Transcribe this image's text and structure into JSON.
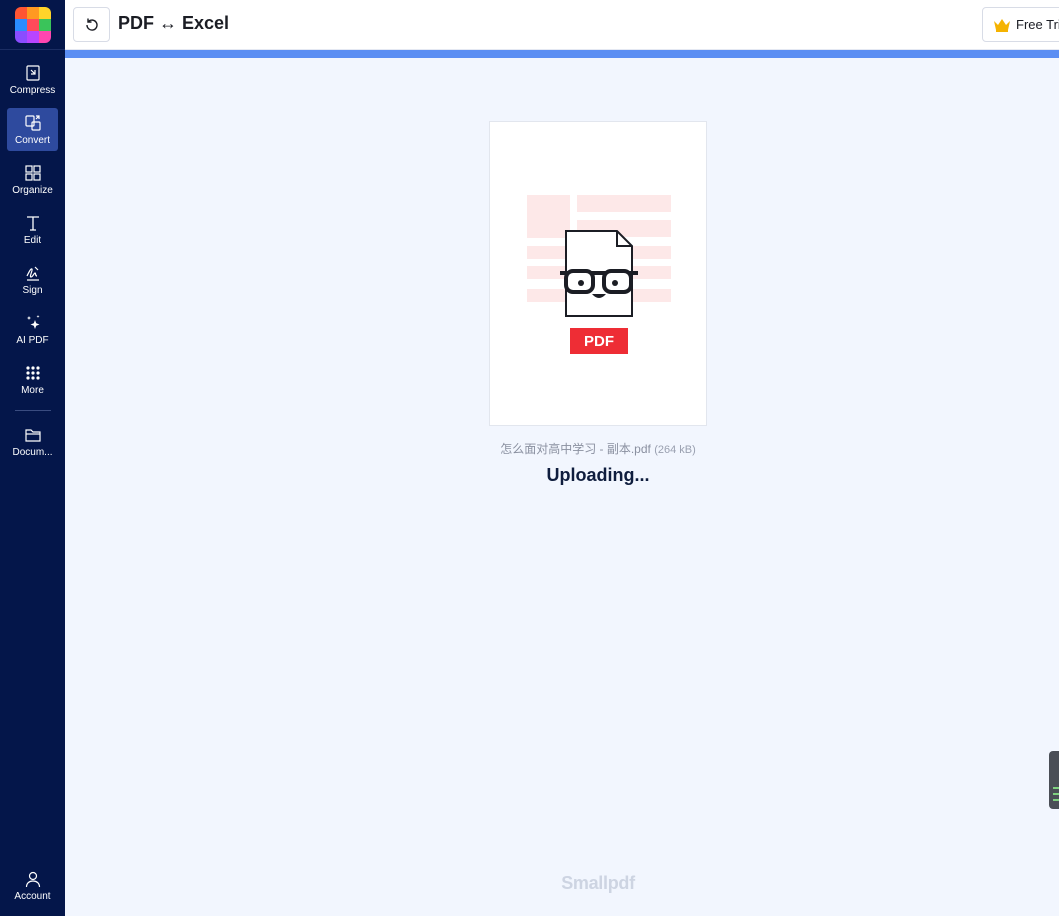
{
  "sidebar": {
    "items": [
      {
        "label": "Compress",
        "icon": "compress-icon",
        "active": false
      },
      {
        "label": "Convert",
        "icon": "convert-icon",
        "active": true
      },
      {
        "label": "Organize",
        "icon": "organize-icon",
        "active": false
      },
      {
        "label": "Edit",
        "icon": "edit-icon",
        "active": false
      },
      {
        "label": "Sign",
        "icon": "sign-icon",
        "active": false
      },
      {
        "label": "AI PDF",
        "icon": "sparkle-icon",
        "active": false
      },
      {
        "label": "More",
        "icon": "more-grid-icon",
        "active": false
      }
    ],
    "documents_label": "Docum...",
    "account_label": "Account"
  },
  "header": {
    "title": "PDF ↔ Excel",
    "trial_label": "Free Tri"
  },
  "main": {
    "card_badge": "PDF",
    "filename": "怎么面对高中学习 - 副本.pdf",
    "filesize": "(264 kB)",
    "status": "Uploading..."
  },
  "footer": {
    "brand": "Smallpdf"
  },
  "colors": {
    "sidebar_bg": "#04164a",
    "active_item": "#2e4a9e",
    "accent_blue": "#5b8ef3",
    "pdf_red": "#ee2d35",
    "page_bg": "#f2f6fe"
  }
}
